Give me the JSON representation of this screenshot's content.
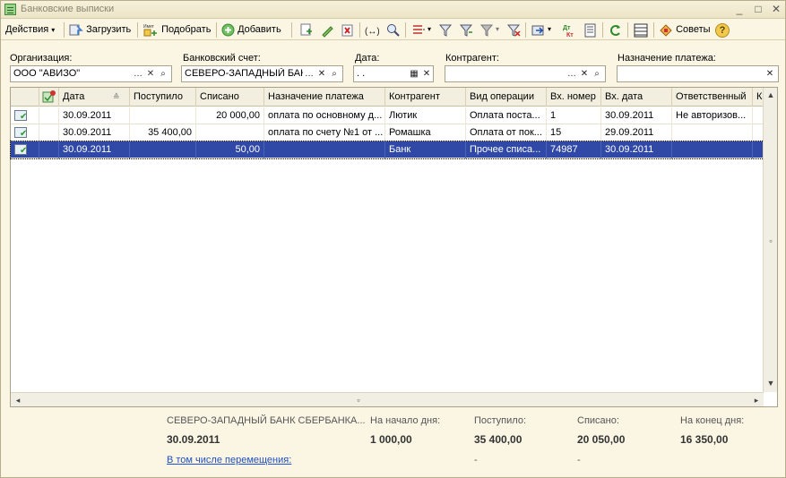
{
  "window": {
    "title": "Банковские выписки",
    "controls": [
      "_",
      "□",
      "✕"
    ]
  },
  "toolbar": {
    "actions": "Действия",
    "load": "Загрузить",
    "pick": "Подобрать",
    "add": "Добавить",
    "advice": "Советы"
  },
  "filters": {
    "organization": {
      "label": "Организация:",
      "value": "ООО \"АВИЗО\""
    },
    "bank_account": {
      "label": "Банковский счет:",
      "value": "СЕВЕРО-ЗАПАДНЫЙ БАНК"
    },
    "date": {
      "label": "Дата:",
      "value": " .  ."
    },
    "counterparty": {
      "label": "Контрагент:",
      "value": ""
    },
    "purpose": {
      "label": "Назначение платежа:",
      "value": ""
    }
  },
  "table": {
    "columns": [
      "Дата",
      "Поступило",
      "Списано",
      "Назначение платежа",
      "Контрагент",
      "Вид операции",
      "Вх. номер",
      "Вх. дата",
      "Ответственный",
      "К"
    ],
    "rows": [
      {
        "date": "30.09.2011",
        "received": "",
        "spent": "20 000,00",
        "purpose": "оплата по основному д...",
        "counterparty": "Лютик",
        "operation": "Оплата поста...",
        "in_number": "1",
        "in_date": "30.09.2011",
        "responsible": "Не авторизов...",
        "selected": false
      },
      {
        "date": "30.09.2011",
        "received": "35 400,00",
        "spent": "",
        "purpose": "оплата по счету №1 от ...",
        "counterparty": "Ромашка",
        "operation": "Оплата от пок...",
        "in_number": "15",
        "in_date": "29.09.2011",
        "responsible": "",
        "selected": false
      },
      {
        "date": "30.09.2011",
        "received": "",
        "spent": "50,00",
        "purpose": "",
        "counterparty": "Банк",
        "operation": "Прочее списа...",
        "in_number": "74987",
        "in_date": "30.09.2011",
        "responsible": "",
        "selected": true
      }
    ]
  },
  "footer": {
    "bank": "СЕВЕРО-ЗАПАДНЫЙ БАНК СБЕРБАНКА...",
    "date": "30.09.2011",
    "movements_link": "В том числе перемещения:",
    "start_label": "На начало дня:",
    "start_value": "1 000,00",
    "received_label": "Поступило:",
    "received_value": "35 400,00",
    "received_moves": "-",
    "spent_label": "Списано:",
    "spent_value": "20 050,00",
    "spent_moves": "-",
    "end_label": "На конец дня:",
    "end_value": "16 350,00"
  }
}
